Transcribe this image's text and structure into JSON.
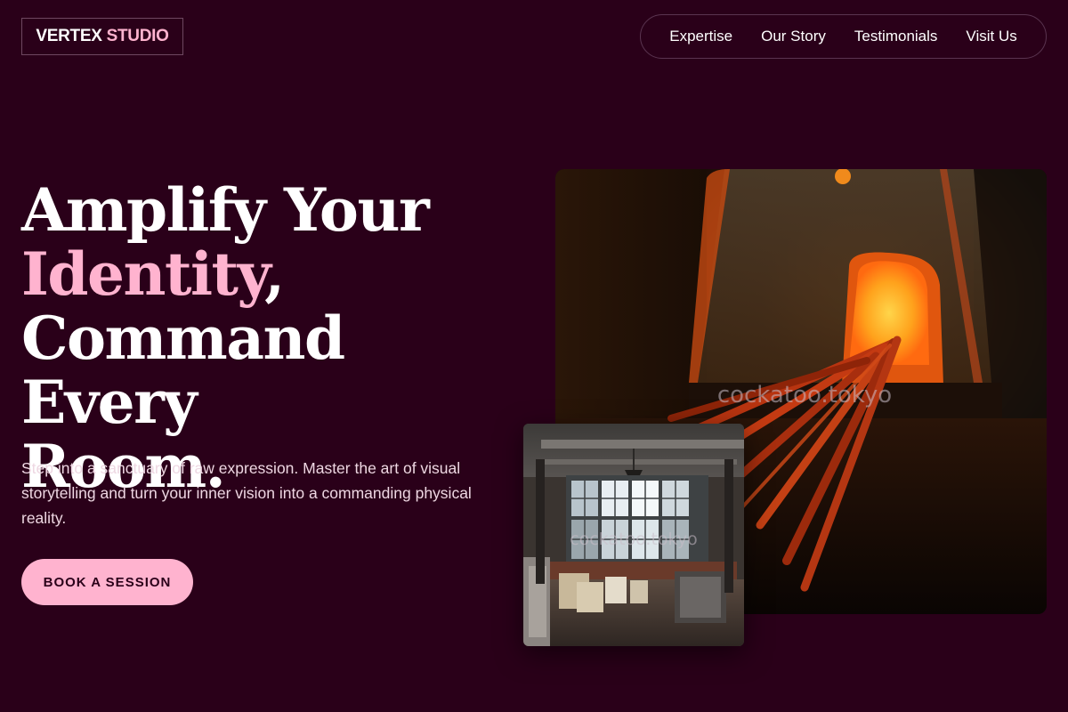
{
  "brand": {
    "name_primary": "VERTEX",
    "name_accent": "STUDIO"
  },
  "nav": {
    "items": [
      {
        "label": "Expertise"
      },
      {
        "label": "Our Story"
      },
      {
        "label": "Testimonials"
      },
      {
        "label": "Visit Us"
      }
    ]
  },
  "hero": {
    "line1": "Amplify Your",
    "line2_accent": "Identity",
    "line2_rest": ",",
    "line3": "Command Every",
    "line4": "Room.",
    "subtext": "Step into a sanctuary of raw expression. Master the art of visual storytelling and turn your inner vision into a commanding physical reality.",
    "cta_label": "BOOK A SESSION"
  },
  "images": {
    "main_watermark": "cockatoo.tokyo",
    "small_watermark": "cockatoo.tokyo"
  },
  "colors": {
    "background": "#2a0019",
    "accent": "#ffb3cf",
    "text": "#ffffff"
  }
}
